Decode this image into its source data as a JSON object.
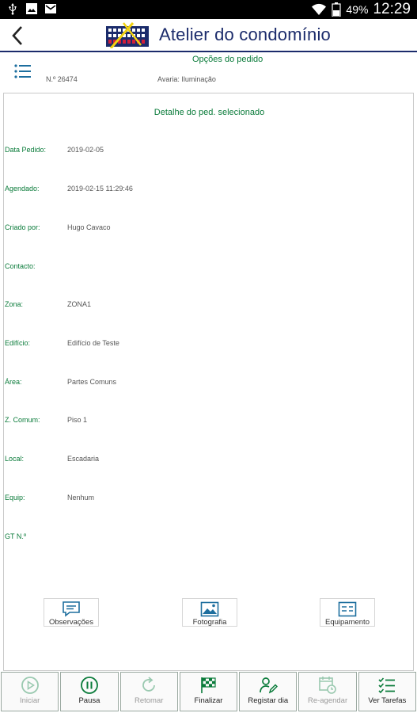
{
  "status_bar": {
    "battery": "49%",
    "time": "12:29"
  },
  "app": {
    "title": "Atelier do condomínio"
  },
  "order": {
    "options_label": "Opções do pedido",
    "number": "N.º 26474",
    "fault": "Avaria: Iluminação"
  },
  "detail": {
    "title": "Detalhe do ped. selecionado",
    "fields": [
      {
        "label": "Data Pedido:",
        "value": "2019-02-05"
      },
      {
        "label": "Agendado:",
        "value": "2019-02-15 11:29:46"
      },
      {
        "label": "Criado por:",
        "value": "Hugo Cavaco"
      },
      {
        "label": "Contacto:",
        "value": ""
      },
      {
        "label": "Zona:",
        "value": "ZONA1"
      },
      {
        "label": "Edifício:",
        "value": "Edifício de Teste"
      },
      {
        "label": "Área:",
        "value": "Partes Comuns"
      },
      {
        "label": "Z. Comum:",
        "value": "Piso 1"
      },
      {
        "label": "Local:",
        "value": "Escadaria"
      },
      {
        "label": "Equip:",
        "value": "Nenhum"
      },
      {
        "label": "GT N.º",
        "value": ""
      }
    ],
    "actions": {
      "observacoes": "Observações",
      "fotografia": "Fotografia",
      "equipamento": "Equipamento"
    }
  },
  "toolbar": [
    {
      "label": "Iniciar",
      "enabled": false,
      "icon": "play-circle-icon"
    },
    {
      "label": "Pausa",
      "enabled": true,
      "icon": "pause-circle-icon"
    },
    {
      "label": "Retomar",
      "enabled": false,
      "icon": "refresh-icon"
    },
    {
      "label": "Finalizar",
      "enabled": true,
      "icon": "checkered-flag-icon"
    },
    {
      "label": "Registar dia",
      "enabled": true,
      "icon": "user-edit-icon"
    },
    {
      "label": "Re-agendar",
      "enabled": false,
      "icon": "calendar-clock-icon"
    },
    {
      "label": "Ver Tarefas",
      "enabled": true,
      "icon": "checklist-icon"
    }
  ],
  "colors": {
    "accent_green": "#0a7b3a",
    "brand_blue": "#1b2b6b",
    "disabled_icon": "#9ac9b0"
  }
}
